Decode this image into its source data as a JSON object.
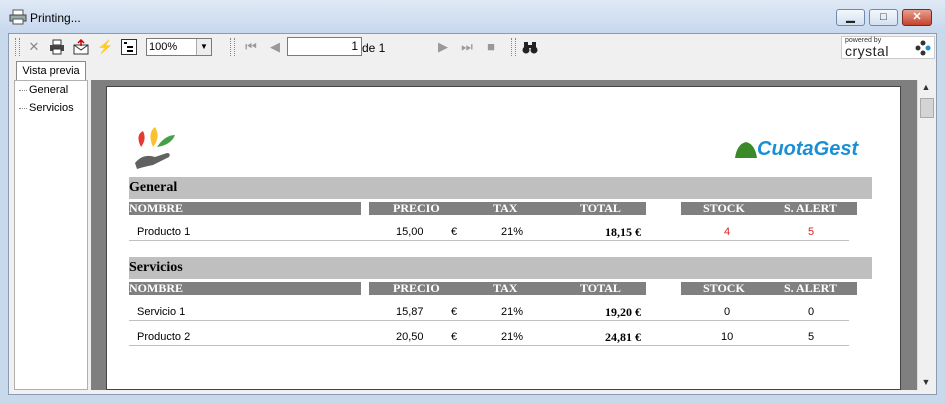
{
  "window": {
    "title": "Printing...",
    "minimize": "▁",
    "maximize": "□",
    "close": "✕"
  },
  "toolbar": {
    "zoom": "100%",
    "page_current": "1",
    "page_of": "de 1",
    "crystal_powered": "powered by",
    "crystal_brand": "crystal"
  },
  "tab": {
    "label": "Vista previa"
  },
  "tree": {
    "items": [
      "General",
      "Servicios"
    ]
  },
  "report": {
    "brand": "CuotaGest",
    "columns": {
      "nombre": "NOMBRE",
      "precio": "PRECIO",
      "tax": "TAX",
      "total": "TOTAL",
      "stock": "STOCK",
      "alert": "S. ALERT"
    },
    "currency": "€",
    "groups": [
      {
        "name": "General",
        "rows": [
          {
            "nombre": "Producto 1",
            "precio": "15,00",
            "tax": "21%",
            "total": "18,15 €",
            "stock": "4",
            "alert": "5",
            "alert_color": "#e02020"
          }
        ]
      },
      {
        "name": "Servicios",
        "rows": [
          {
            "nombre": "Servicio 1",
            "precio": "15,87",
            "tax": "21%",
            "total": "19,20 €",
            "stock": "0",
            "alert": "0"
          },
          {
            "nombre": "Producto 2",
            "precio": "20,50",
            "tax": "21%",
            "total": "24,81 €",
            "stock": "10",
            "alert": "5"
          }
        ]
      }
    ]
  },
  "colors": {
    "brand_blue": "#1a8fd4",
    "brand_green": "#3a8a2a",
    "highlight_red": "#e02020",
    "group_bar": "#bfbfbf",
    "header_bar": "#808080"
  }
}
